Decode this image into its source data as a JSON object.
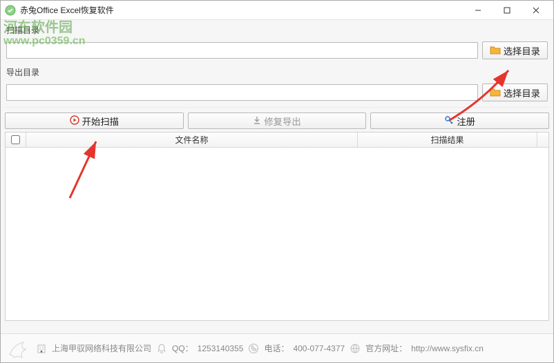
{
  "window": {
    "title": "赤兔Office Excel恢复软件"
  },
  "watermark": {
    "line1": "河东软件园",
    "url": "www.pc0359.cn"
  },
  "scan_dir": {
    "label": "扫描目录",
    "value": "",
    "browse_label": "选择目录"
  },
  "export_dir": {
    "label": "导出目录",
    "value": "",
    "browse_label": "选择目录"
  },
  "actions": {
    "start_scan": "开始扫描",
    "repair_export": "修复导出",
    "register": "注册"
  },
  "columns": {
    "filename": "文件名称",
    "scan_result": "扫描结果"
  },
  "footer": {
    "company": "上海甲驭网络科技有限公司",
    "qq_label": "QQ：",
    "qq_value": "1253140355",
    "tel_label": "电话：",
    "tel_value": "400-077-4377",
    "site_label": "官方网址：",
    "site_value": "http://www.sysfix.cn"
  },
  "icons": {
    "folder_color": "#f5b63a",
    "play_color": "#d23b30",
    "export_color": "#9a9a9a",
    "key_color": "#2d72d2"
  }
}
